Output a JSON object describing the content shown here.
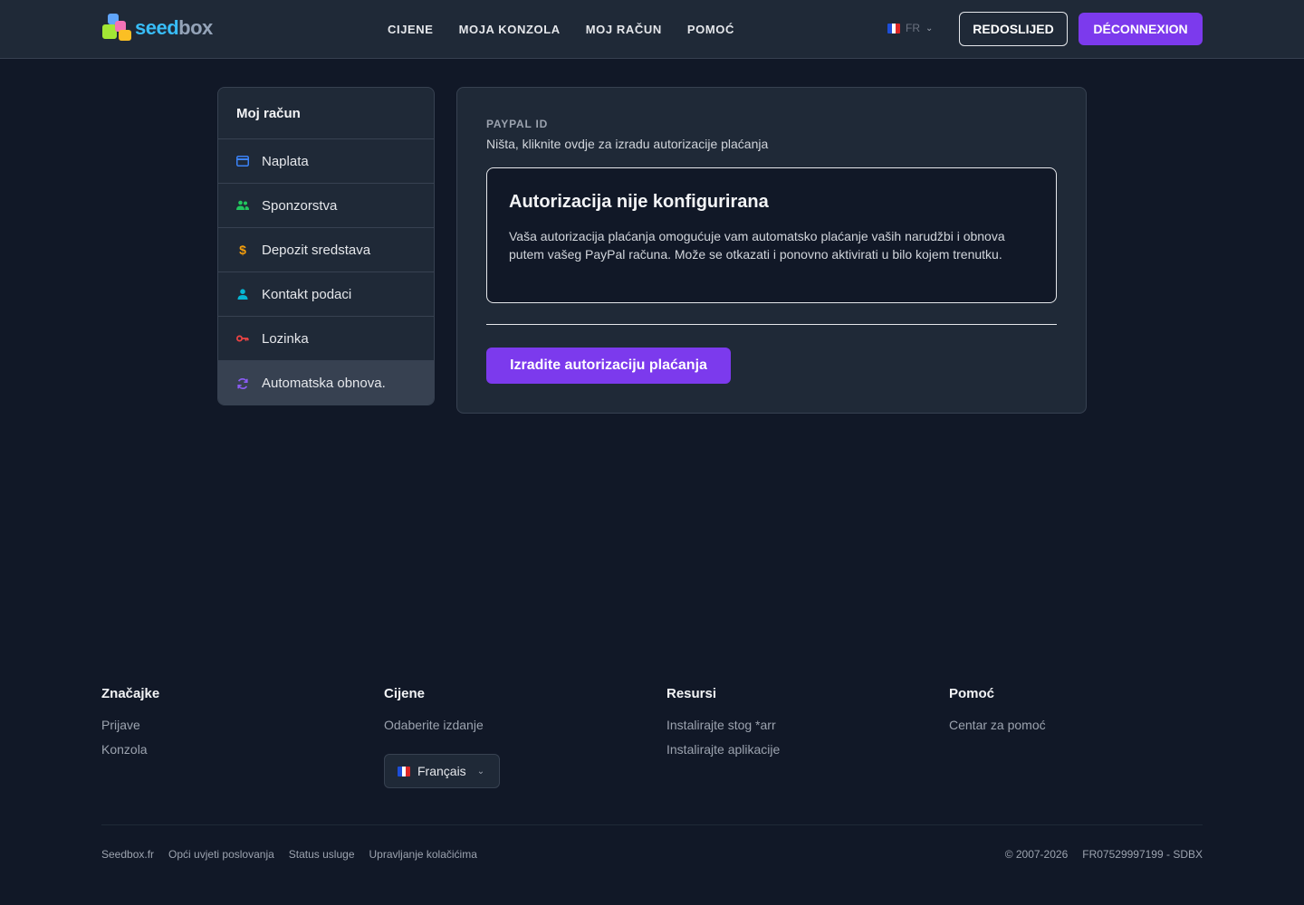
{
  "header": {
    "logo_text_a": "seed",
    "logo_text_b": "box",
    "nav": [
      "CIJENE",
      "MOJA KONZOLA",
      "MOJ RAČUN",
      "POMOĆ"
    ],
    "lang_code": "FR",
    "order_button": "REDOSLIJED",
    "logout_button": "DÉCONNEXION"
  },
  "sidebar": {
    "title": "Moj račun",
    "items": [
      {
        "label": "Naplata",
        "icon": "credit-card-icon",
        "color": "#3b82f6"
      },
      {
        "label": "Sponzorstva",
        "icon": "users-icon",
        "color": "#22c55e"
      },
      {
        "label": "Depozit sredstava",
        "icon": "dollar-icon",
        "color": "#f59e0b"
      },
      {
        "label": "Kontakt podaci",
        "icon": "user-icon",
        "color": "#06b6d4"
      },
      {
        "label": "Lozinka",
        "icon": "key-icon",
        "color": "#ef4444"
      },
      {
        "label": "Automatska obnova.",
        "icon": "refresh-icon",
        "color": "#8b5cf6"
      }
    ]
  },
  "main": {
    "field_label": "PAYPAL ID",
    "field_value": "Ništa, kliknite ovdje za izradu autorizacije plaćanja",
    "notice_title": "Autorizacija nije konfigurirana",
    "notice_text": "Vaša autorizacija plaćanja omogućuje vam automatsko plaćanje vaših narudžbi i obnova putem vašeg PayPal računa. Može se otkazati i ponovno aktivirati u bilo kojem trenutku.",
    "create_button": "Izradite autorizaciju plaćanja"
  },
  "footer": {
    "columns": [
      {
        "title": "Značajke",
        "links": [
          "Prijave",
          "Konzola"
        ]
      },
      {
        "title": "Cijene",
        "links": [
          "Odaberite izdanje"
        ]
      },
      {
        "title": "Resursi",
        "links": [
          "Instalirajte stog *arr",
          "Instalirajte aplikacije"
        ]
      },
      {
        "title": "Pomoć",
        "links": [
          "Centar za pomoć"
        ]
      }
    ],
    "language_select": "Français",
    "bottom_links": [
      "Seedbox.fr",
      "Opći uvjeti poslovanja",
      "Status usluge",
      "Upravljanje kolačićima"
    ],
    "copyright": "© 2007-2026",
    "company_id": "FR07529997199 - SDBX"
  },
  "colors": {
    "background": "#111827",
    "panel": "#1f2937",
    "accent": "#7c3aed"
  }
}
